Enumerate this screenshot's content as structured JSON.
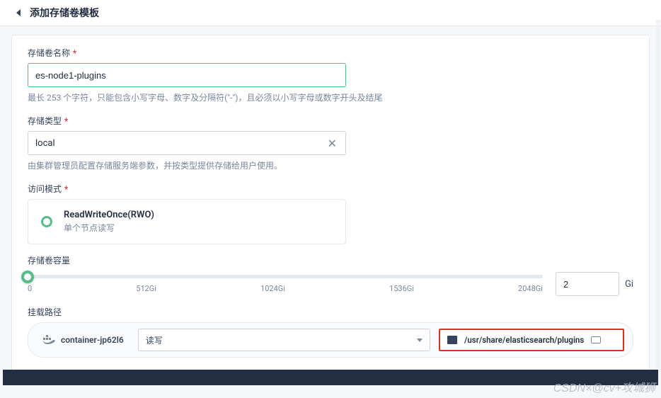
{
  "header": {
    "title": "添加存储卷模板"
  },
  "fields": {
    "name": {
      "label": "存储卷名称",
      "value": "es-node1-plugins",
      "help": "最长 253 个字符，只能包含小写字母、数字及分隔符(\"-\")，且必须以小写字母或数字开头及结尾"
    },
    "type": {
      "label": "存储类型",
      "value": "local",
      "help": "由集群管理员配置存储服务端参数，并按类型提供存储给用户使用。"
    },
    "access": {
      "label": "访问模式",
      "option_title": "ReadWriteOnce(RWO)",
      "option_sub": "单个节点读写"
    },
    "capacity": {
      "label": "存储卷容量",
      "value": "2",
      "unit": "Gi",
      "ticks": [
        "0",
        "512Gi",
        "1024Gi",
        "1536Gi",
        "2048Gi"
      ]
    },
    "mount": {
      "label": "挂载路径",
      "container": "container-jp62l6",
      "mode": "读写",
      "path": "/usr/share/elasticsearch/plugins"
    }
  },
  "watermark": "CSDN×@cv+攻城狮"
}
